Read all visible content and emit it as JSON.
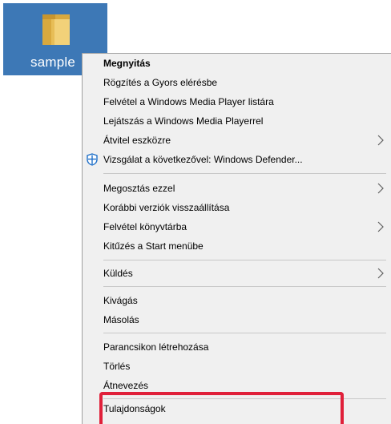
{
  "desktop": {
    "folder_label": "sample"
  },
  "menu": {
    "items": [
      {
        "label": "Megnyitás",
        "bold": true
      },
      {
        "label": "Rögzítés a Gyors elérésbe"
      },
      {
        "label": "Felvétel a Windows Media Player listára"
      },
      {
        "label": "Lejátszás a Windows Media Playerrel"
      },
      {
        "label": "Átvitel eszközre",
        "submenu": true
      },
      {
        "label": "Vizsgálat a következővel: Windows Defender...",
        "icon": "windows-defender-icon"
      },
      {
        "label": "Megosztás ezzel",
        "submenu": true
      },
      {
        "label": "Korábbi verziók visszaállítása"
      },
      {
        "label": "Felvétel könyvtárba",
        "submenu": true
      },
      {
        "label": "Kitűzés a Start menübe"
      },
      {
        "label": "Küldés",
        "submenu": true
      },
      {
        "label": "Kivágás"
      },
      {
        "label": "Másolás"
      },
      {
        "label": "Parancsikon létrehozása"
      },
      {
        "label": "Törlés"
      },
      {
        "label": "Átnevezés"
      },
      {
        "label": "Tulajdonságok"
      }
    ]
  },
  "colors": {
    "selection_bg": "#3d78b6",
    "menu_bg": "#f0f0f0",
    "highlight": "#e0203a",
    "folder": "#e8c66a"
  }
}
